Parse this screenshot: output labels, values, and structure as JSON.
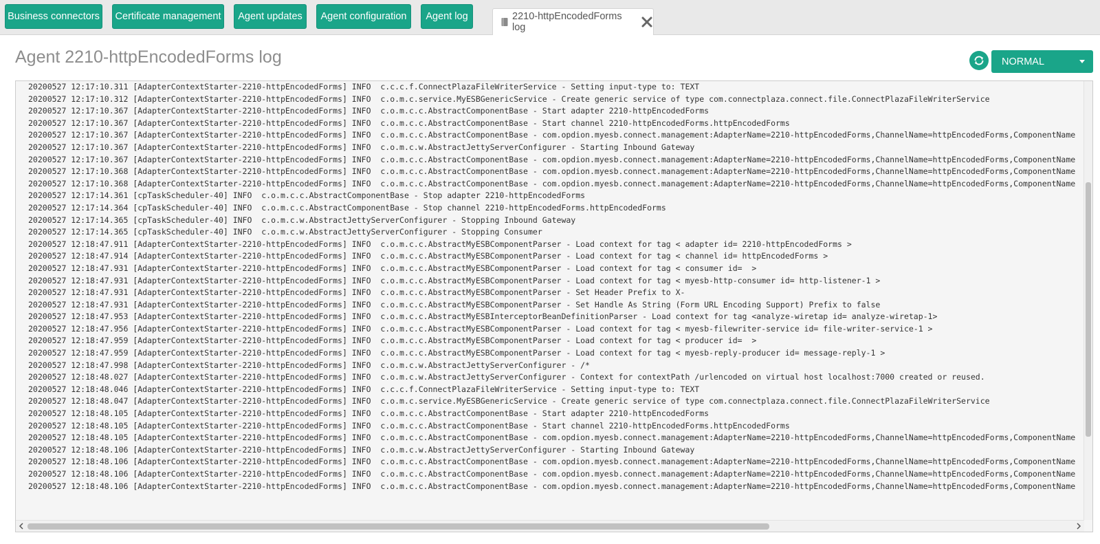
{
  "colors": {
    "accent": "#1aa589",
    "title": "#8d8d8d",
    "log_bg": "#f5f5f5"
  },
  "tabs": [
    {
      "label": "Business connectors",
      "icon": ""
    },
    {
      "label": "Certificate management",
      "icon": ""
    },
    {
      "label": "Agent updates",
      "icon": ""
    },
    {
      "label": "Agent configuration",
      "icon": ""
    },
    {
      "label": "Agent log",
      "icon": ""
    }
  ],
  "active_tab": {
    "label": "2210-httpEncodedForms log",
    "icon": "document-icon",
    "close_icon": "close-icon"
  },
  "header": {
    "title": "Agent 2210-httpEncodedForms log"
  },
  "toolbar": {
    "refresh_icon": "refresh-icon",
    "log_level": "NORMAL"
  },
  "log": {
    "vertical_scroll_position": 0.55,
    "vertical_thumb_fraction": 0.58,
    "horizontal_thumb_fraction": 0.71,
    "lines": [
      "20200527 12:17:10.311 [AdapterContextStarter-2210-httpEncodedForms] INFO  c.c.c.f.ConnectPlazaFileWriterService - Setting input-type to: TEXT",
      "20200527 12:17:10.312 [AdapterContextStarter-2210-httpEncodedForms] INFO  c.o.m.c.service.MyESBGenericService - Create generic service of type com.connectplaza.connect.file.ConnectPlazaFileWriterService",
      "20200527 12:17:10.367 [AdapterContextStarter-2210-httpEncodedForms] INFO  c.o.m.c.c.AbstractComponentBase - Start adapter 2210-httpEncodedForms",
      "20200527 12:17:10.367 [AdapterContextStarter-2210-httpEncodedForms] INFO  c.o.m.c.c.AbstractComponentBase - Start channel 2210-httpEncodedForms.httpEncodedForms",
      "20200527 12:17:10.367 [AdapterContextStarter-2210-httpEncodedForms] INFO  c.o.m.c.c.AbstractComponentBase - com.opdion.myesb.connect.management:AdapterName=2210-httpEncodedForms,ChannelName=httpEncodedForms,ComponentName",
      "20200527 12:17:10.367 [AdapterContextStarter-2210-httpEncodedForms] INFO  c.o.m.c.w.AbstractJettyServerConfigurer - Starting Inbound Gateway",
      "20200527 12:17:10.367 [AdapterContextStarter-2210-httpEncodedForms] INFO  c.o.m.c.c.AbstractComponentBase - com.opdion.myesb.connect.management:AdapterName=2210-httpEncodedForms,ChannelName=httpEncodedForms,ComponentName",
      "20200527 12:17:10.368 [AdapterContextStarter-2210-httpEncodedForms] INFO  c.o.m.c.c.AbstractComponentBase - com.opdion.myesb.connect.management:AdapterName=2210-httpEncodedForms,ChannelName=httpEncodedForms,ComponentName",
      "20200527 12:17:10.368 [AdapterContextStarter-2210-httpEncodedForms] INFO  c.o.m.c.c.AbstractComponentBase - com.opdion.myesb.connect.management:AdapterName=2210-httpEncodedForms,ChannelName=httpEncodedForms,ComponentName",
      "20200527 12:17:14.361 [cpTaskScheduler-40] INFO  c.o.m.c.c.AbstractComponentBase - Stop adapter 2210-httpEncodedForms",
      "20200527 12:17:14.364 [cpTaskScheduler-40] INFO  c.o.m.c.c.AbstractComponentBase - Stop channel 2210-httpEncodedForms.httpEncodedForms",
      "20200527 12:17:14.365 [cpTaskScheduler-40] INFO  c.o.m.c.w.AbstractJettyServerConfigurer - Stopping Inbound Gateway",
      "20200527 12:17:14.365 [cpTaskScheduler-40] INFO  c.o.m.c.w.AbstractJettyServerConfigurer - Stopping Consumer",
      "20200527 12:18:47.911 [AdapterContextStarter-2210-httpEncodedForms] INFO  c.o.m.c.c.AbstractMyESBComponentParser - Load context for tag < adapter id= 2210-httpEncodedForms >",
      "20200527 12:18:47.914 [AdapterContextStarter-2210-httpEncodedForms] INFO  c.o.m.c.c.AbstractMyESBComponentParser - Load context for tag < channel id= httpEncodedForms >",
      "20200527 12:18:47.931 [AdapterContextStarter-2210-httpEncodedForms] INFO  c.o.m.c.c.AbstractMyESBComponentParser - Load context for tag < consumer id=  >",
      "20200527 12:18:47.931 [AdapterContextStarter-2210-httpEncodedForms] INFO  c.o.m.c.c.AbstractMyESBComponentParser - Load context for tag < myesb-http-consumer id= http-listener-1 >",
      "20200527 12:18:47.931 [AdapterContextStarter-2210-httpEncodedForms] INFO  c.o.m.c.c.AbstractMyESBComponentParser - Set Header Prefix to X-",
      "20200527 12:18:47.931 [AdapterContextStarter-2210-httpEncodedForms] INFO  c.o.m.c.c.AbstractMyESBComponentParser - Set Handle As String (Form URL Encoding Support) Prefix to false",
      "20200527 12:18:47.953 [AdapterContextStarter-2210-httpEncodedForms] INFO  c.o.m.c.c.AbstractMyESBInterceptorBeanDefinitionParser - Load context for tag <analyze-wiretap id= analyze-wiretap-1>",
      "20200527 12:18:47.956 [AdapterContextStarter-2210-httpEncodedForms] INFO  c.o.m.c.c.AbstractMyESBComponentParser - Load context for tag < myesb-filewriter-service id= file-writer-service-1 >",
      "20200527 12:18:47.959 [AdapterContextStarter-2210-httpEncodedForms] INFO  c.o.m.c.c.AbstractMyESBComponentParser - Load context for tag < producer id=  >",
      "20200527 12:18:47.959 [AdapterContextStarter-2210-httpEncodedForms] INFO  c.o.m.c.c.AbstractMyESBComponentParser - Load context for tag < myesb-reply-producer id= message-reply-1 >",
      "20200527 12:18:47.998 [AdapterContextStarter-2210-httpEncodedForms] INFO  c.o.m.c.w.AbstractJettyServerConfigurer - /*",
      "20200527 12:18:48.027 [AdapterContextStarter-2210-httpEncodedForms] INFO  c.o.m.c.w.AbstractJettyServerConfigurer - Context for contextPath /urlencoded on virtual host localhost:7000 created or reused.",
      "20200527 12:18:48.046 [AdapterContextStarter-2210-httpEncodedForms] INFO  c.c.c.f.ConnectPlazaFileWriterService - Setting input-type to: TEXT",
      "20200527 12:18:48.047 [AdapterContextStarter-2210-httpEncodedForms] INFO  c.o.m.c.service.MyESBGenericService - Create generic service of type com.connectplaza.connect.file.ConnectPlazaFileWriterService",
      "20200527 12:18:48.105 [AdapterContextStarter-2210-httpEncodedForms] INFO  c.o.m.c.c.AbstractComponentBase - Start adapter 2210-httpEncodedForms",
      "20200527 12:18:48.105 [AdapterContextStarter-2210-httpEncodedForms] INFO  c.o.m.c.c.AbstractComponentBase - Start channel 2210-httpEncodedForms.httpEncodedForms",
      "20200527 12:18:48.105 [AdapterContextStarter-2210-httpEncodedForms] INFO  c.o.m.c.c.AbstractComponentBase - com.opdion.myesb.connect.management:AdapterName=2210-httpEncodedForms,ChannelName=httpEncodedForms,ComponentName",
      "20200527 12:18:48.106 [AdapterContextStarter-2210-httpEncodedForms] INFO  c.o.m.c.w.AbstractJettyServerConfigurer - Starting Inbound Gateway",
      "20200527 12:18:48.106 [AdapterContextStarter-2210-httpEncodedForms] INFO  c.o.m.c.c.AbstractComponentBase - com.opdion.myesb.connect.management:AdapterName=2210-httpEncodedForms,ChannelName=httpEncodedForms,ComponentName",
      "20200527 12:18:48.106 [AdapterContextStarter-2210-httpEncodedForms] INFO  c.o.m.c.c.AbstractComponentBase - com.opdion.myesb.connect.management:AdapterName=2210-httpEncodedForms,ChannelName=httpEncodedForms,ComponentName",
      "20200527 12:18:48.106 [AdapterContextStarter-2210-httpEncodedForms] INFO  c.o.m.c.c.AbstractComponentBase - com.opdion.myesb.connect.management:AdapterName=2210-httpEncodedForms,ChannelName=httpEncodedForms,ComponentName"
    ]
  }
}
